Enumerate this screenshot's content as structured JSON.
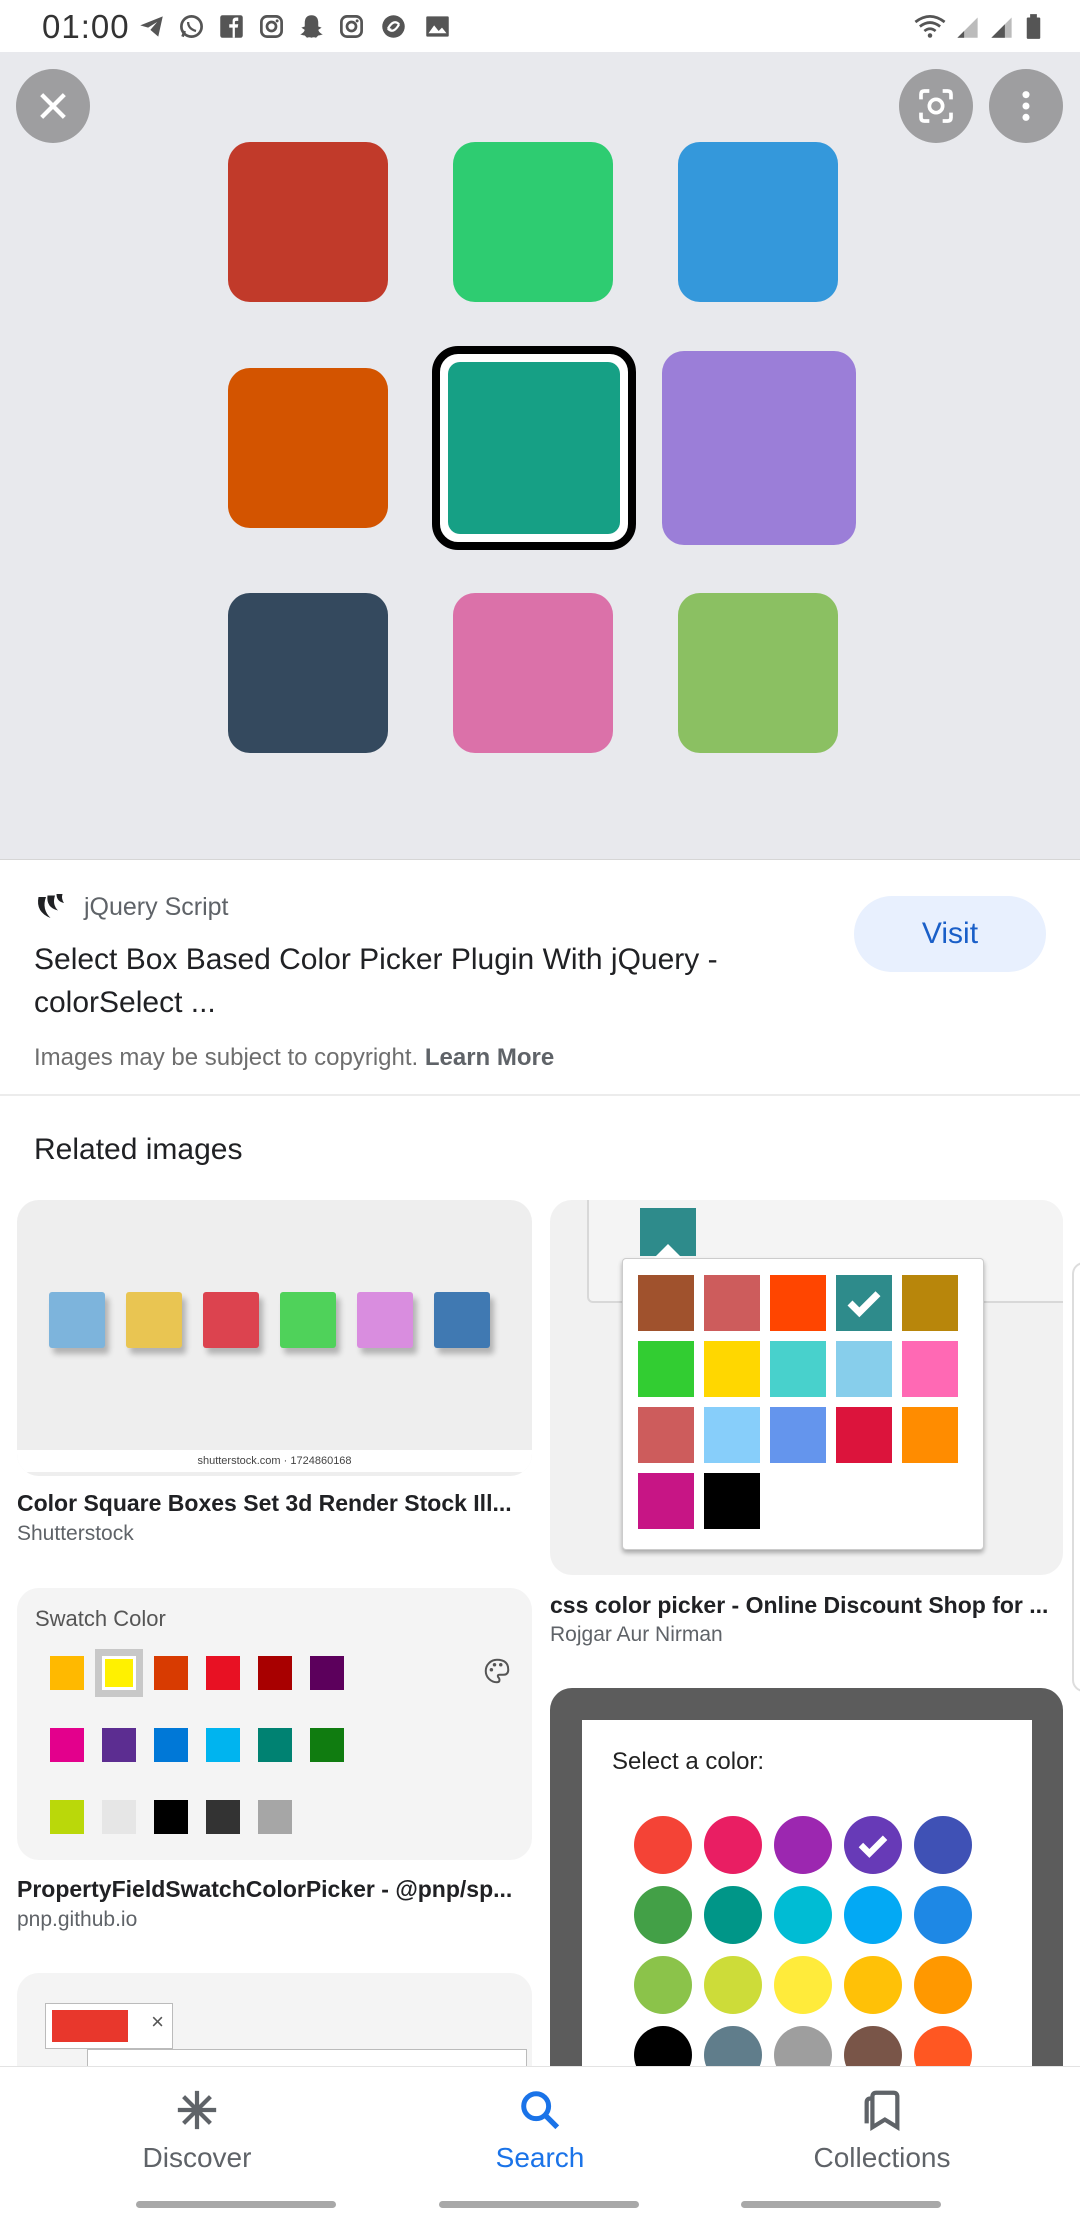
{
  "status_bar": {
    "time": "01:00",
    "icons": [
      "telegram-icon",
      "whatsapp-icon",
      "facebook-icon",
      "instagram-icon",
      "snapchat-icon",
      "instagram-icon",
      "vpn-icon",
      "image-icon",
      "wifi-icon",
      "signal-icon",
      "signal-icon",
      "battery-icon"
    ]
  },
  "hero": {
    "background": "#e8e9ed",
    "swatches": [
      "#c13a2a",
      "#2ecc71",
      "#3498db",
      "#d35400",
      "#16a085",
      "#9b7ed8",
      "#34495e",
      "#db71a9",
      "#8bc062"
    ],
    "selected_index": 4,
    "buttons": [
      "close-icon",
      "lens-icon",
      "more-icon"
    ]
  },
  "result": {
    "source_name": "jQuery Script",
    "title_line1": "Select Box Based Color Picker Plugin With jQuery -",
    "title_line2": "colorSelect ...",
    "visit_label": "Visit",
    "copyright_text": "Images may be subject to copyright.",
    "learn_more": "Learn More"
  },
  "related": {
    "heading": "Related images",
    "cards": [
      {
        "title": "Color Square Boxes Set 3d Render Stock Ill...",
        "source": "Shutterstock",
        "watermark": "shutterstock.com · 1724860168",
        "colors": [
          "#7db4dc",
          "#e9c552",
          "#dc434f",
          "#4fd25a",
          "#d98ddf",
          "#4079b2"
        ]
      },
      {
        "title": "css color picker - Online Discount Shop for ...",
        "source": "Rojgar Aur Nirman",
        "colors": [
          "#a0522d",
          "#cd5c5c",
          "#ff4500",
          "#2e8b8b",
          "#b8860b",
          "#32cd32",
          "#ffd700",
          "#48d1cc",
          "#87ceeb",
          "#ff69b4",
          "#cd5c5c",
          "#87cefa",
          "#6495ed",
          "#dc143c",
          "#ff8c00",
          "#c71585",
          "#000000"
        ]
      },
      {
        "title": "PropertyFieldSwatchColorPicker - @pnp/sp...",
        "source": "pnp.github.io",
        "heading": "Swatch Color",
        "colors": [
          "#ffb900",
          "#fff100",
          "#d83b01",
          "#e81123",
          "#a80000",
          "#5c005c",
          "#e3008c",
          "#5c2d91",
          "#0078d7",
          "#00b4ef",
          "#008272",
          "#107c10",
          "#bad80a",
          "#e6e6e6",
          "#000000",
          "#333333",
          "#a6a6a6"
        ]
      },
      {
        "heading": "Select a color:",
        "colors": [
          "#f44336",
          "#e91e63",
          "#9c27b0",
          "#673ab7",
          "#3f51b5",
          "#43a047",
          "#009688",
          "#00bcd4",
          "#03a9f4",
          "#1e88e5",
          "#8bc34a",
          "#cddc39",
          "#ffeb3b",
          "#ffc107",
          "#ff9800",
          "#000000",
          "#607d8b",
          "#9e9e9e",
          "#795548",
          "#ff5722"
        ]
      }
    ]
  },
  "bottom_nav": {
    "items": [
      {
        "label": "Discover",
        "icon": "asterisk-icon",
        "active": false
      },
      {
        "label": "Search",
        "icon": "search-icon",
        "active": true
      },
      {
        "label": "Collections",
        "icon": "bookmarks-icon",
        "active": false
      }
    ],
    "active_color": "#1a73e8",
    "inactive_color": "#5f6368"
  }
}
